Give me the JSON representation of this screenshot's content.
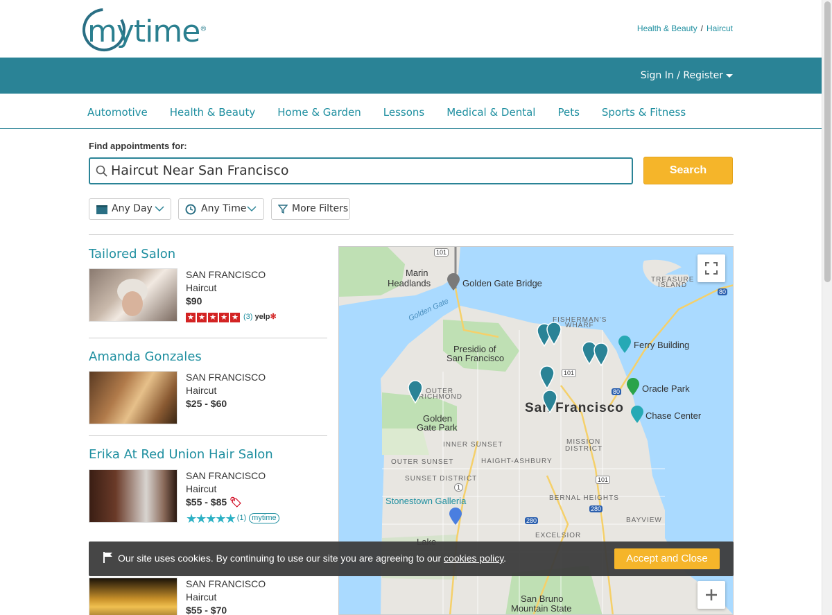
{
  "brand": {
    "logo_text": "mytime",
    "logo_mark": "®"
  },
  "breadcrumb": {
    "items": [
      "Health & Beauty",
      "Haircut"
    ],
    "separator": "/"
  },
  "header": {
    "signin_label": "Sign In / Register"
  },
  "categories": [
    "Automotive",
    "Health & Beauty",
    "Home & Garden",
    "Lessons",
    "Medical & Dental",
    "Pets",
    "Sports & Fitness"
  ],
  "search": {
    "label": "Find appointments for:",
    "value": "Haircut Near San Francisco",
    "button_label": "Search"
  },
  "filters": {
    "day": "Any Day",
    "time": "Any Time",
    "more": "More Filters"
  },
  "listings": [
    {
      "name": "Tailored Salon",
      "city": "SAN FRANCISCO",
      "service": "Haircut",
      "price": "$90",
      "rating_count": "(3)",
      "rating_source": "yelp"
    },
    {
      "name": "Amanda Gonzales",
      "city": "SAN FRANCISCO",
      "service": "Haircut",
      "price": "$25 - $60"
    },
    {
      "name": "Erika At Red Union Hair Salon",
      "city": "SAN FRANCISCO",
      "service": "Haircut",
      "price": "$55 - $85",
      "rating_count": "(1)",
      "rating_source": "mytime"
    },
    {
      "name": "",
      "city": "SAN FRANCISCO",
      "service": "Haircut",
      "price": "$55 - $70"
    }
  ],
  "map": {
    "labels": {
      "marin": "Marin",
      "headlands": "Headlands",
      "golden_gate_bridge": "Golden Gate Bridge",
      "golden_gate": "Golden Gate",
      "treasure": "TREASURE",
      "island": "ISLAND",
      "fishermans": "FISHERMAN'S",
      "wharf": "WHARF",
      "presidio": "Presidio of",
      "presidio2": "San Francisco",
      "ferry": "Ferry Building",
      "outer": "OUTER",
      "richmond": "RICHMOND",
      "oracle": "Oracle Park",
      "sf": "San Francisco",
      "chase": "Chase Center",
      "golden_gate_park": "Golden",
      "golden_gate_park2": "Gate Park",
      "haight": "HAIGHT-ASHBURY",
      "inner_sunset": "INNER SUNSET",
      "mission": "MISSION",
      "district": "DISTRICT",
      "outer_sunset": "OUTER SUNSET",
      "sunset_district": "SUNSET DISTRICT",
      "stonestown": "Stonestown Galleria",
      "bernal": "BERNAL HEIGHTS",
      "bayview": "BAYVIEW",
      "excelsior": "EXCELSIOR",
      "lake": "Lake",
      "san_bruno": "San Bruno",
      "mountain_state": "Mountain State",
      "hw101a": "101",
      "hw101b": "101",
      "hw101c": "101",
      "hw80a": "80",
      "hw80b": "80",
      "hw280a": "280",
      "hw280b": "280",
      "hw1": "1"
    }
  },
  "cookie": {
    "message": "Our site uses cookies. By continuing to use our site you are agreeing to our",
    "link": "cookies policy",
    "period": ".",
    "accept_label": "Accept and Close"
  },
  "colors": {
    "brand": "#2a8396",
    "link": "#1f8fa0",
    "accent": "#f5b52a",
    "yelp": "#d32323"
  }
}
